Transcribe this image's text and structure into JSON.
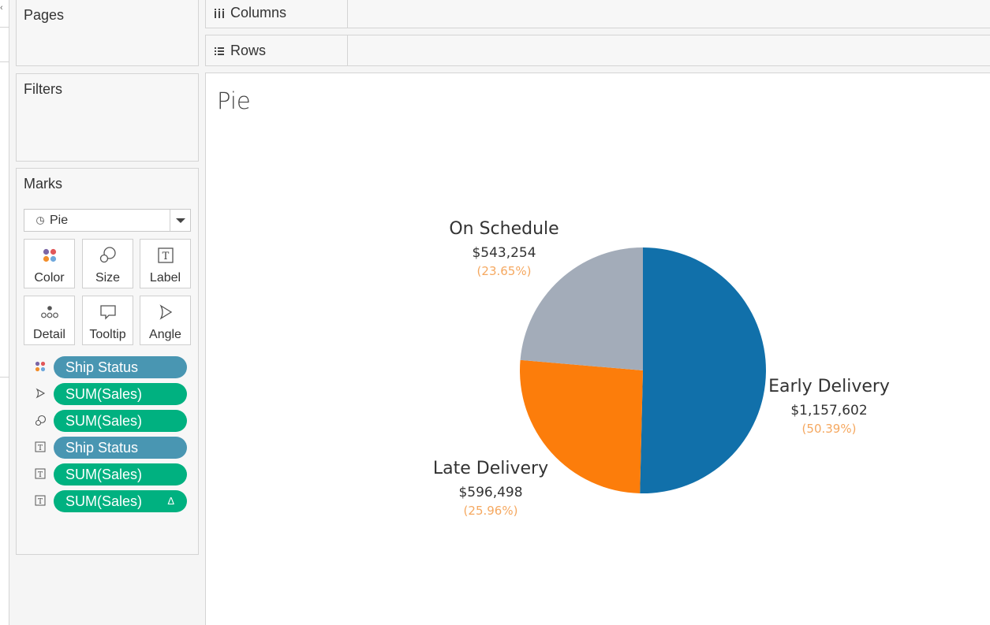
{
  "shelves": {
    "pages": "Pages",
    "filters": "Filters",
    "marks": "Marks",
    "columns": "Columns",
    "rows": "Rows"
  },
  "marks": {
    "mark_type": "Pie",
    "buttons": [
      "Color",
      "Size",
      "Label",
      "Detail",
      "Tooltip",
      "Angle"
    ],
    "fields": [
      {
        "type": "color",
        "kind": "dimension",
        "label": "Ship Status",
        "icon": "color-icon"
      },
      {
        "type": "angle",
        "kind": "measure",
        "label": "SUM(Sales)",
        "icon": "angle-icon"
      },
      {
        "type": "size",
        "kind": "measure",
        "label": "SUM(Sales)",
        "icon": "size-icon"
      },
      {
        "type": "label",
        "kind": "dimension",
        "label": "Ship Status",
        "icon": "label-icon"
      },
      {
        "type": "label",
        "kind": "measure",
        "label": "SUM(Sales)",
        "icon": "label-icon"
      },
      {
        "type": "label",
        "kind": "measure",
        "label": "SUM(Sales)",
        "icon": "label-icon",
        "delta": "Δ"
      }
    ]
  },
  "view": {
    "title": "Pie"
  },
  "colors": {
    "dimension_pill": "#4996b2",
    "measure_pill": "#00b180",
    "percent_text": "#f5a860"
  },
  "chart_data": {
    "type": "pie",
    "title": "Pie",
    "slices": [
      {
        "name": "Early Delivery",
        "value": 1157602,
        "value_label": "$1,157,602",
        "percent_label": "(50.39%)",
        "color": "#1170aa"
      },
      {
        "name": "Late Delivery",
        "value": 596498,
        "value_label": "$596,498",
        "percent_label": "(25.96%)",
        "color": "#fc7d0b"
      },
      {
        "name": "On Schedule",
        "value": 543254,
        "value_label": "$543,254",
        "percent_label": "(23.65%)",
        "color": "#a3acb9"
      }
    ]
  }
}
